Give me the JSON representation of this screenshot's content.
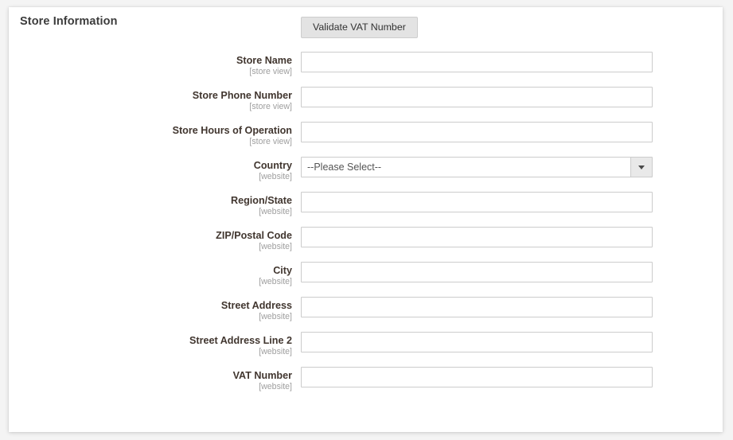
{
  "section": {
    "title": "Store Information"
  },
  "fields": [
    {
      "label": "Store Name",
      "scope": "[store view]",
      "type": "text",
      "value": "",
      "placeholder": ""
    },
    {
      "label": "Store Phone Number",
      "scope": "[store view]",
      "type": "text",
      "value": "",
      "placeholder": ""
    },
    {
      "label": "Store Hours of Operation",
      "scope": "[store view]",
      "type": "text",
      "value": "",
      "placeholder": ""
    },
    {
      "label": "Country",
      "scope": "[website]",
      "type": "select",
      "value": "--Please Select--",
      "placeholder": ""
    },
    {
      "label": "Region/State",
      "scope": "[website]",
      "type": "text",
      "value": "",
      "placeholder": ""
    },
    {
      "label": "ZIP/Postal Code",
      "scope": "[website]",
      "type": "text",
      "value": "",
      "placeholder": ""
    },
    {
      "label": "City",
      "scope": "[website]",
      "type": "text",
      "value": "",
      "placeholder": ""
    },
    {
      "label": "Street Address",
      "scope": "[website]",
      "type": "text",
      "value": "",
      "placeholder": ""
    },
    {
      "label": "Street Address Line 2",
      "scope": "[website]",
      "type": "text",
      "value": "",
      "placeholder": ""
    },
    {
      "label": "VAT Number",
      "scope": "[website]",
      "type": "text",
      "value": "",
      "placeholder": ""
    }
  ],
  "actions": {
    "validate_vat_label": "Validate VAT Number"
  },
  "icons": {
    "select_caret": "chevron-down-icon"
  },
  "colors": {
    "page_background": "#f4f4f4",
    "card_background": "#ffffff",
    "label_text": "#41362f",
    "scope_text": "#9e9e9e",
    "input_border": "#cccccc",
    "button_background": "#e3e3e3"
  }
}
